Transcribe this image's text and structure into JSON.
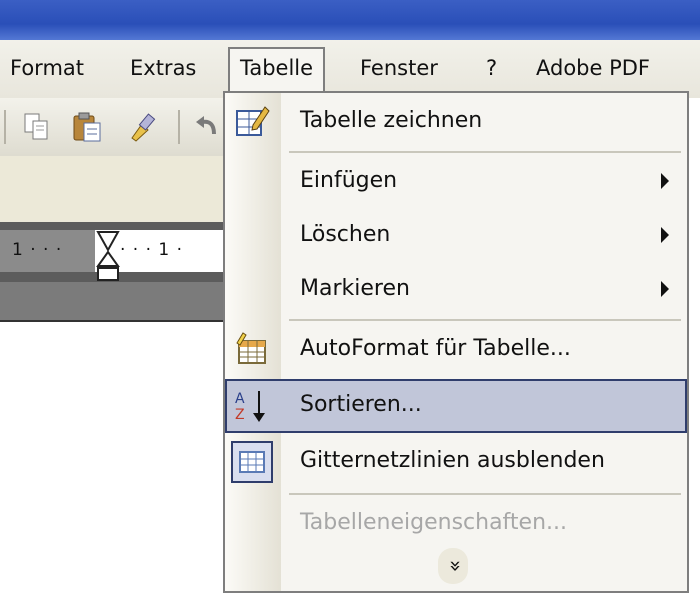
{
  "menubar": {
    "items": [
      {
        "label": "Format"
      },
      {
        "label": "Extras"
      },
      {
        "label": "Tabelle"
      },
      {
        "label": "Fenster"
      },
      {
        "label": "?"
      },
      {
        "label": "Adobe PDF"
      }
    ]
  },
  "ruler": {
    "left_text": "1 · · ·",
    "right_text": "· · · 1 ·"
  },
  "dropdown": {
    "items": [
      {
        "label": "Tabelle zeichnen",
        "icon": "pencil-table-icon"
      },
      {
        "label": "Einfügen",
        "submenu": true
      },
      {
        "label": "Löschen",
        "submenu": true
      },
      {
        "label": "Markieren",
        "submenu": true
      },
      {
        "label": "AutoFormat für Tabelle...",
        "icon": "autoformat-icon"
      },
      {
        "label": "Sortieren...",
        "icon": "sort-az-icon",
        "highlighted": true
      },
      {
        "label": "Gitternetzlinien ausblenden",
        "icon": "gridlines-icon"
      },
      {
        "label": "Tabelleneigenschaften...",
        "disabled": true
      }
    ],
    "expand_glyph": "»"
  },
  "colors": {
    "title_bar": "#2a4fb8",
    "highlight": "#c1c6d9",
    "disabled_text": "#a7a7a7"
  }
}
